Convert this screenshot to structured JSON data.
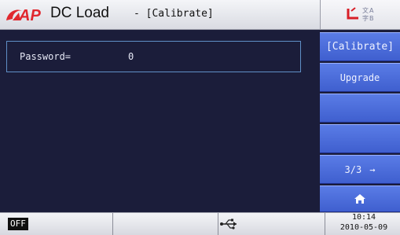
{
  "window": {
    "title": "DC Load",
    "subtitle": "- [Calibrate]"
  },
  "branding": {
    "logo_text": "AP",
    "logo_icon": "brand-logo",
    "logo_color": "#e0282f"
  },
  "top_right": {
    "icon": "language-switch-icon"
  },
  "main": {
    "password_label": "Password=",
    "password_value": "0"
  },
  "menu": {
    "items": [
      {
        "label": "[Calibrate]"
      },
      {
        "label": "Upgrade"
      },
      {
        "label": ""
      },
      {
        "label": ""
      },
      {
        "label": "3/3",
        "icon": "arrow-right-icon",
        "icon_glyph": "→"
      },
      {
        "label": "",
        "icon": "home-icon"
      }
    ]
  },
  "status": {
    "output_state": "OFF",
    "usb_icon": "usb-icon",
    "time": "10:14",
    "date": "2010-05-09"
  },
  "colors": {
    "background": "#1b1d3a",
    "menu_button": "#4a6ad9",
    "field_border": "#5f8fc6",
    "titlebar": "#e6e7ec"
  }
}
